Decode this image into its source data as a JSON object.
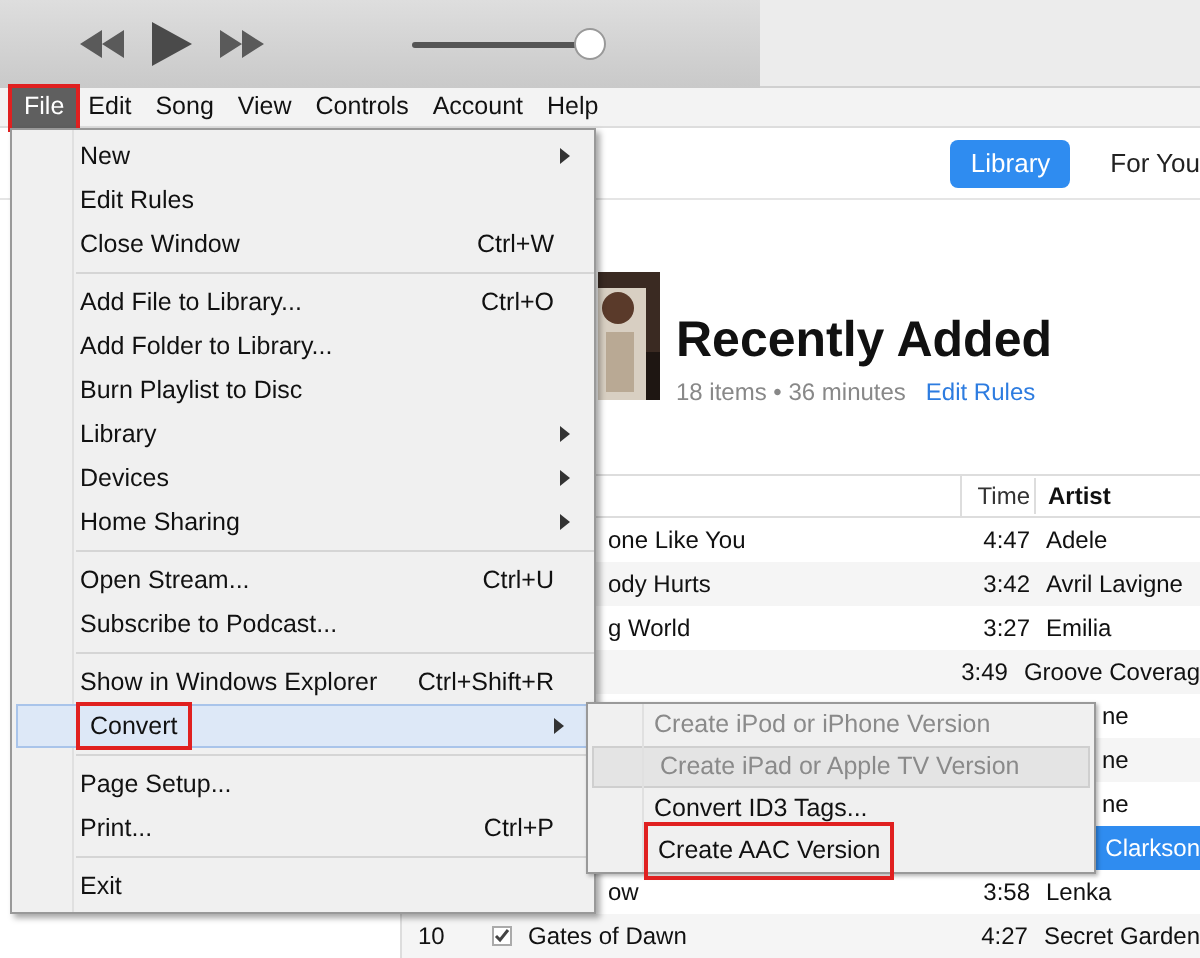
{
  "player": {
    "volume": {
      "level": 0.97
    }
  },
  "menubar": [
    {
      "label": "File",
      "selected": true,
      "annotated": true
    },
    {
      "label": "Edit",
      "selected": false,
      "annotated": false
    },
    {
      "label": "Song",
      "selected": false,
      "annotated": false
    },
    {
      "label": "View",
      "selected": false,
      "annotated": false
    },
    {
      "label": "Controls",
      "selected": false,
      "annotated": false
    },
    {
      "label": "Account",
      "selected": false,
      "annotated": false
    },
    {
      "label": "Help",
      "selected": false,
      "annotated": false
    }
  ],
  "nav_tabs": [
    {
      "label": "Library",
      "selected": true
    },
    {
      "label": "For You",
      "selected": false
    }
  ],
  "playlist": {
    "title": "Recently Added",
    "summary": "18 items • 36 minutes",
    "edit_link": "Edit Rules"
  },
  "table": {
    "columns": [
      "Time",
      "Artist"
    ],
    "rows": [
      {
        "kind": "under_menu",
        "name": "one Like You",
        "time": "4:47",
        "artist": "Adele",
        "selected": false
      },
      {
        "kind": "under_menu",
        "name": "ody Hurts",
        "time": "3:42",
        "artist": "Avril Lavigne",
        "selected": false
      },
      {
        "kind": "under_menu",
        "name": "g World",
        "time": "3:27",
        "artist": "Emilia",
        "selected": false
      },
      {
        "kind": "under_menu",
        "time": "3:49",
        "artist": "Groove Coverag",
        "selected": false
      },
      {
        "kind": "under_submenu",
        "artist": "ne",
        "selected": false
      },
      {
        "kind": "under_submenu",
        "artist": "ne",
        "selected": false
      },
      {
        "kind": "under_submenu",
        "artist": "ne",
        "selected": false
      },
      {
        "kind": "under_submenu",
        "artist": " Clarkson",
        "selected": true
      },
      {
        "kind": "under_menu",
        "name": "ow",
        "time": "3:58",
        "artist": "Lenka",
        "selected": false
      },
      {
        "kind": "full",
        "number": "10",
        "checked": true,
        "name": "Gates of Dawn",
        "time": "4:27",
        "artist": "Secret Garden",
        "selected": false
      }
    ]
  },
  "file_menu": [
    {
      "kind": "item",
      "label": "New",
      "submenu": true,
      "selected": false,
      "annotated": false
    },
    {
      "kind": "item",
      "label": "Edit Rules",
      "submenu": false,
      "selected": false,
      "annotated": false
    },
    {
      "kind": "item",
      "label": "Close Window",
      "shortcut": "Ctrl+W",
      "submenu": false,
      "selected": false,
      "annotated": false
    },
    {
      "kind": "separator"
    },
    {
      "kind": "item",
      "label": "Add File to Library...",
      "shortcut": "Ctrl+O",
      "submenu": false,
      "selected": false,
      "annotated": false
    },
    {
      "kind": "item",
      "label": "Add Folder to Library...",
      "submenu": false,
      "selected": false,
      "annotated": false
    },
    {
      "kind": "item",
      "label": "Burn Playlist to Disc",
      "submenu": false,
      "selected": false,
      "annotated": false
    },
    {
      "kind": "item",
      "label": "Library",
      "submenu": true,
      "selected": false,
      "annotated": false
    },
    {
      "kind": "item",
      "label": "Devices",
      "submenu": true,
      "selected": false,
      "annotated": false
    },
    {
      "kind": "item",
      "label": "Home Sharing",
      "submenu": true,
      "selected": false,
      "annotated": false
    },
    {
      "kind": "separator"
    },
    {
      "kind": "item",
      "label": "Open Stream...",
      "shortcut": "Ctrl+U",
      "submenu": false,
      "selected": false,
      "annotated": false
    },
    {
      "kind": "item",
      "label": "Subscribe to Podcast...",
      "submenu": false,
      "selected": false,
      "annotated": false
    },
    {
      "kind": "separator"
    },
    {
      "kind": "item",
      "label": "Show in Windows Explorer",
      "shortcut": "Ctrl+Shift+R",
      "submenu": false,
      "selected": false,
      "annotated": false
    },
    {
      "kind": "item",
      "label": "Convert",
      "submenu": true,
      "selected": true,
      "annotated": true
    },
    {
      "kind": "separator"
    },
    {
      "kind": "item",
      "label": "Page Setup...",
      "submenu": false,
      "selected": false,
      "annotated": false
    },
    {
      "kind": "item",
      "label": "Print...",
      "shortcut": "Ctrl+P",
      "submenu": false,
      "selected": false,
      "annotated": false
    },
    {
      "kind": "separator"
    },
    {
      "kind": "item",
      "label": "Exit",
      "submenu": false,
      "selected": false,
      "annotated": false
    }
  ],
  "convert_submenu": [
    {
      "label": "Create iPod or iPhone Version",
      "disabled": true,
      "hovered": false,
      "annotated": false
    },
    {
      "label": "Create iPad or Apple TV Version",
      "disabled": true,
      "hovered": true,
      "annotated": false
    },
    {
      "label": "Convert ID3 Tags...",
      "disabled": false,
      "hovered": false,
      "annotated": false
    },
    {
      "label": "Create AAC Version",
      "disabled": false,
      "hovered": false,
      "annotated": true
    }
  ]
}
